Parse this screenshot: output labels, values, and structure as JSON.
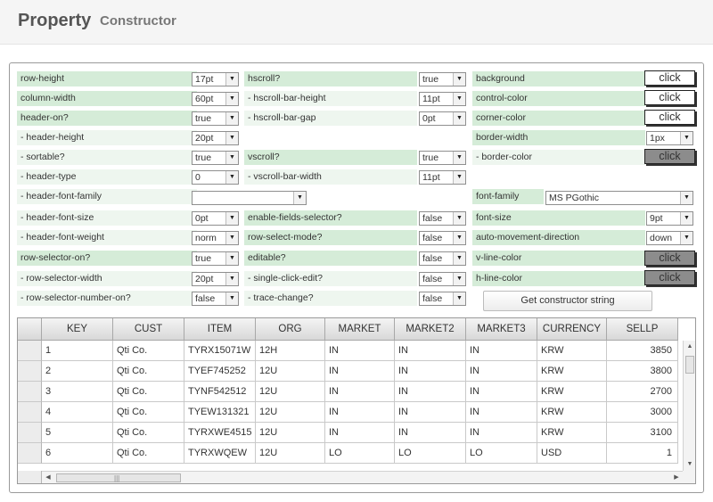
{
  "header": {
    "title": "Property",
    "subtitle": "Constructor"
  },
  "props": {
    "row_height": {
      "label": "row-height",
      "value": "17pt"
    },
    "column_width": {
      "label": "column-width",
      "value": "60pt"
    },
    "header_on": {
      "label": "header-on?",
      "value": "true"
    },
    "header_height": {
      "label": "- header-height",
      "value": "20pt"
    },
    "sortable": {
      "label": "- sortable?",
      "value": "true"
    },
    "header_type": {
      "label": "- header-type",
      "value": "0"
    },
    "header_font_family": {
      "label": "- header-font-family",
      "value": ""
    },
    "header_font_size": {
      "label": "- header-font-size",
      "value": "0pt"
    },
    "header_font_weight": {
      "label": "- header-font-weight",
      "value": "norm"
    },
    "row_selector_on": {
      "label": "row-selector-on?",
      "value": "true"
    },
    "row_selector_width": {
      "label": "- row-selector-width",
      "value": "20pt"
    },
    "row_selector_number_on": {
      "label": "- row-selector-number-on?",
      "value": "false"
    },
    "hscroll": {
      "label": "hscroll?",
      "value": "true"
    },
    "hscroll_bar_height": {
      "label": "- hscroll-bar-height",
      "value": "11pt"
    },
    "hscroll_bar_gap": {
      "label": "- hscroll-bar-gap",
      "value": "0pt"
    },
    "vscroll": {
      "label": "vscroll?",
      "value": "true"
    },
    "vscroll_bar_width": {
      "label": "- vscroll-bar-width",
      "value": "11pt"
    },
    "enable_fields_selector": {
      "label": "enable-fields-selector?",
      "value": "false"
    },
    "row_select_mode": {
      "label": "row-select-mode?",
      "value": "false"
    },
    "editable": {
      "label": "editable?",
      "value": "false"
    },
    "single_click_edit": {
      "label": "- single-click-edit?",
      "value": "false"
    },
    "trace_change": {
      "label": "- trace-change?",
      "value": "false"
    },
    "background": {
      "label": "background",
      "button": "click"
    },
    "control_color": {
      "label": "control-color",
      "button": "click"
    },
    "corner_color": {
      "label": "corner-color",
      "button": "click"
    },
    "border_width": {
      "label": "border-width",
      "value": "1px"
    },
    "border_color": {
      "label": "- border-color",
      "button": "click"
    },
    "font_family": {
      "label": "font-family",
      "value": "MS PGothic"
    },
    "font_size": {
      "label": "font-size",
      "value": "9pt"
    },
    "auto_movement_direction": {
      "label": "auto-movement-direction",
      "value": "down"
    },
    "v_line_color": {
      "label": "v-line-color",
      "button": "click"
    },
    "h_line_color": {
      "label": "h-line-color",
      "button": "click"
    }
  },
  "get_constructor_label": "Get constructor string",
  "grid": {
    "columns": [
      "KEY",
      "CUST",
      "ITEM",
      "ORG",
      "MARKET",
      "MARKET2",
      "MARKET3",
      "CURRENCY",
      "SELLP"
    ],
    "rows": [
      [
        "1",
        "Qti Co.",
        "TYRX15071W",
        "12H",
        "IN",
        "IN",
        "IN",
        "KRW",
        "3850"
      ],
      [
        "2",
        "Qti Co.",
        "TYEF745252",
        "12U",
        "IN",
        "IN",
        "IN",
        "KRW",
        "3800"
      ],
      [
        "3",
        "Qti Co.",
        "TYNF542512",
        "12U",
        "IN",
        "IN",
        "IN",
        "KRW",
        "2700"
      ],
      [
        "4",
        "Qti Co.",
        "TYEW131321",
        "12U",
        "IN",
        "IN",
        "IN",
        "KRW",
        "3000"
      ],
      [
        "5",
        "Qti Co.",
        "TYRXWE4515",
        "12U",
        "IN",
        "IN",
        "IN",
        "KRW",
        "3100"
      ],
      [
        "6",
        "Qti Co.",
        "TYRXWQEW",
        "12U",
        "LO",
        "LO",
        "LO",
        "USD",
        "1"
      ]
    ]
  },
  "icons": {
    "dropdown": "▼",
    "scroll_up": "▲",
    "scroll_down": "▼",
    "scroll_left": "◀",
    "scroll_right": "▶",
    "grip": "|||"
  }
}
